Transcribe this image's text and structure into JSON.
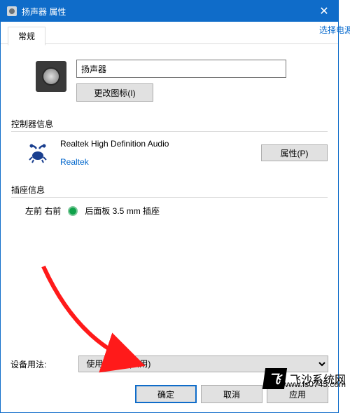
{
  "window": {
    "title": "扬声器 属性",
    "close_glyph": "✕"
  },
  "side_link": "选择电源",
  "tab": {
    "general": "常规"
  },
  "device": {
    "name": "扬声器",
    "change_icon_btn": "更改图标(I)"
  },
  "controller": {
    "group_label": "控制器信息",
    "name": "Realtek High Definition Audio",
    "vendor": "Realtek",
    "properties_btn": "属性(P)"
  },
  "jack": {
    "group_label": "插座信息",
    "location": "左前 右前",
    "desc": "后面板 3.5 mm 插座",
    "color": "#0fa24a"
  },
  "usage": {
    "label": "设备用法:",
    "value": "使用此设备(启用)"
  },
  "footer": {
    "ok": "确定",
    "cancel": "取消",
    "apply_partial": "应用"
  },
  "watermark": {
    "badge": "飞",
    "text": "飞沙系统网",
    "url": "www.fs0745.com"
  }
}
